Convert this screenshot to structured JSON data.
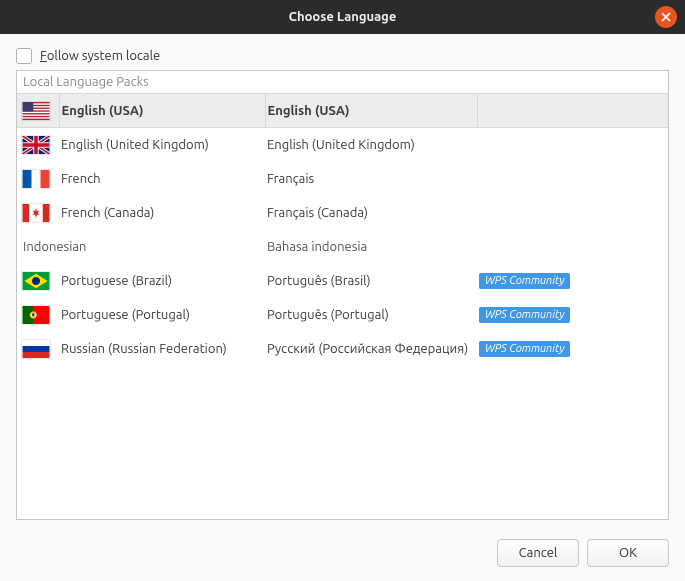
{
  "titlebar": {
    "title": "Choose Language"
  },
  "follow_locale": {
    "label_pre": "F",
    "label_post": "ollow system locale",
    "checked": false
  },
  "list_header": "Local Language Packs",
  "badge_label": "WPS Community",
  "languages": [
    {
      "flag": "us",
      "english": "English (USA)",
      "native": "English (USA)",
      "badge": false,
      "selected": true,
      "has_flag": true
    },
    {
      "flag": "gb",
      "english": "English (United Kingdom)",
      "native": "English (United Kingdom)",
      "badge": false,
      "selected": false,
      "has_flag": true
    },
    {
      "flag": "fr",
      "english": "French",
      "native": "Français",
      "badge": false,
      "selected": false,
      "has_flag": true
    },
    {
      "flag": "ca",
      "english": "French (Canada)",
      "native": "Français (Canada)",
      "badge": false,
      "selected": false,
      "has_flag": true
    },
    {
      "flag": "",
      "english": "Indonesian",
      "native": "Bahasa indonesia",
      "badge": false,
      "selected": false,
      "has_flag": false
    },
    {
      "flag": "br",
      "english": "Portuguese (Brazil)",
      "native": "Português (Brasil)",
      "badge": true,
      "selected": false,
      "has_flag": true
    },
    {
      "flag": "pt",
      "english": "Portuguese (Portugal)",
      "native": "Português (Portugal)",
      "badge": true,
      "selected": false,
      "has_flag": true
    },
    {
      "flag": "ru",
      "english": "Russian (Russian Federation)",
      "native": "Русский (Российская Федерация)",
      "badge": true,
      "selected": false,
      "has_flag": true
    }
  ],
  "buttons": {
    "cancel": "Cancel",
    "ok": "OK"
  }
}
